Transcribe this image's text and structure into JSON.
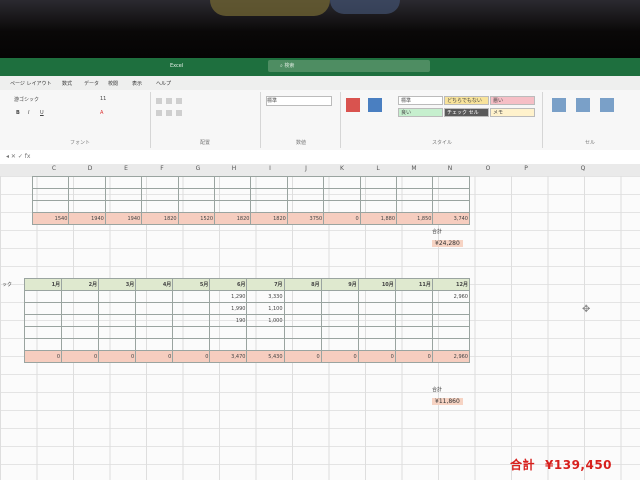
{
  "window": {
    "title": "Excel",
    "search_placeholder": "検索"
  },
  "menu": [
    "ページ レイアウト",
    "数式",
    "データ",
    "校閲",
    "表示",
    "ヘルプ"
  ],
  "ribbon": {
    "font_name": "游ゴシック",
    "font_size": "11",
    "number_format": "標準",
    "groups": [
      "フォント",
      "配置",
      "数値",
      "スタイル",
      "セル"
    ],
    "styles": [
      {
        "label": "標準",
        "bg": "#ffffff"
      },
      {
        "label": "どちらでもない",
        "bg": "#f8e39b"
      },
      {
        "label": "悪い",
        "bg": "#f6bfc6"
      },
      {
        "label": "良い",
        "bg": "#c6efce"
      },
      {
        "label": "チェック セル",
        "bg": "#5a5a5a"
      },
      {
        "label": "メモ",
        "bg": "#fff2cc"
      }
    ]
  },
  "columns": [
    "C",
    "D",
    "E",
    "F",
    "G",
    "H",
    "I",
    "J",
    "K",
    "L",
    "M",
    "N",
    "O",
    "P",
    "Q"
  ],
  "block1": {
    "sum_row": [
      "1540",
      "1940",
      "1940",
      "1820",
      "1520",
      "1820",
      "1820",
      "3750",
      "0",
      "1,880",
      "1,850",
      "3,740"
    ],
    "total_label": "合計",
    "total_value": "¥24,280"
  },
  "block2": {
    "row_label": "ック",
    "months": [
      "1月",
      "2月",
      "3月",
      "4月",
      "5月",
      "6月",
      "7月",
      "8月",
      "9月",
      "10月",
      "11月",
      "12月"
    ],
    "rows": [
      [
        "",
        "",
        "",
        "",
        "",
        "1,290",
        "3,330",
        "",
        "",
        "",
        "",
        "2,960"
      ],
      [
        "",
        "",
        "",
        "",
        "",
        "1,990",
        "1,100",
        "",
        "",
        "",
        "",
        ""
      ],
      [
        "",
        "",
        "",
        "",
        "",
        "190",
        "1,000",
        "",
        "",
        "",
        "",
        ""
      ],
      [
        "",
        "",
        "",
        "",
        "",
        "",
        "",
        "",
        "",
        "",
        "",
        ""
      ],
      [
        "",
        "",
        "",
        "",
        "",
        "",
        "",
        "",
        "",
        "",
        "",
        ""
      ]
    ],
    "sum_row": [
      "0",
      "0",
      "0",
      "0",
      "0",
      "3,470",
      "5,430",
      "0",
      "0",
      "0",
      "0",
      "2,960"
    ],
    "total_label": "合計",
    "total_value": "¥11,860"
  },
  "grand_total": {
    "label": "合計",
    "value": "¥139,450"
  },
  "colors": {
    "excel_green": "#1e6f3e",
    "sum_row": "#f6cdbf",
    "header_row": "#dfe9cf",
    "grand_total_red": "#d7201d"
  }
}
